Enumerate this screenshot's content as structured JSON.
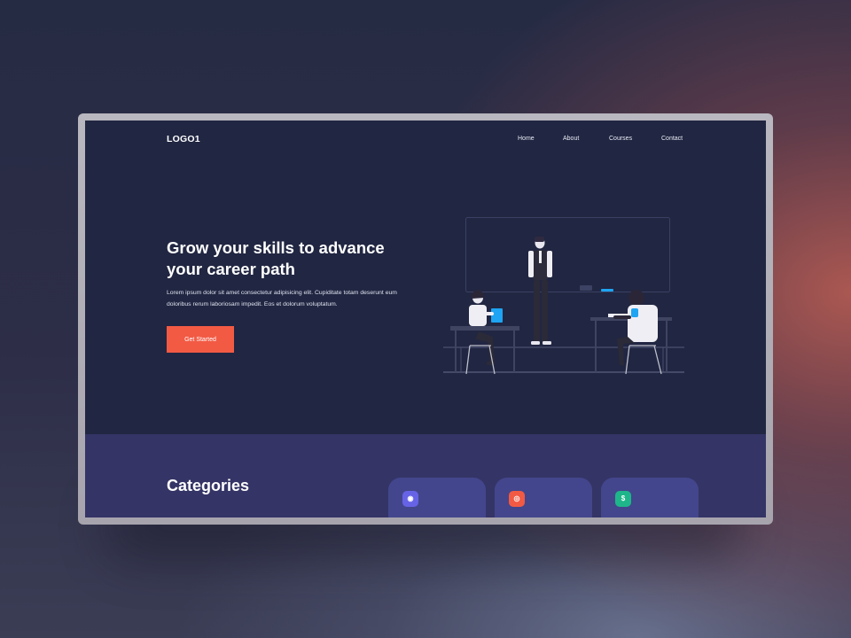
{
  "nav": {
    "logo": "LOGO1",
    "links": [
      {
        "label": "Home"
      },
      {
        "label": "About"
      },
      {
        "label": "Courses"
      },
      {
        "label": "Contact"
      }
    ]
  },
  "hero": {
    "title": "Grow your skills to advance your career path",
    "body": "Lorem ipsum dolor sit amet consectetur adipisicing elit. Cupiditate totam deserunt eum doloribus rerum laboriosam impedit. Eos et dolorum voluptatum.",
    "cta_label": "Get Started"
  },
  "categories": {
    "title": "Categories",
    "cards": [
      {
        "icon": "coin-icon",
        "glyph": "◉",
        "color": "#6763e6"
      },
      {
        "icon": "target-icon",
        "glyph": "◎",
        "color": "#f25a44"
      },
      {
        "icon": "dollar-icon",
        "glyph": "$",
        "color": "#1fb58a"
      }
    ]
  },
  "colors": {
    "accent": "#f25a44",
    "hero_bg": "#212642",
    "categories_bg": "#343466",
    "card_bg": "#43468c",
    "illustration_highlight": "#1ea4f2"
  }
}
